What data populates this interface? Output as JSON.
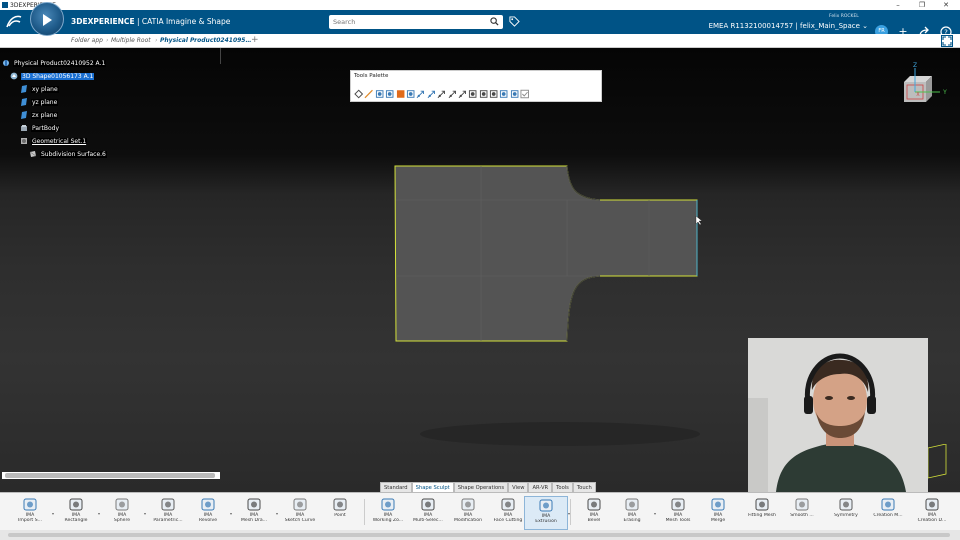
{
  "os": {
    "title": "3DEXPERIENCE"
  },
  "header": {
    "brand_bold": "3DEXPERIENCE",
    "brand_rest": " | CATIA Imagine & Shape",
    "search_placeholder": "Search",
    "user_name": "Felix ROCKEL",
    "avatar_initials": "FR",
    "tenant": "EMEA R1132100014757 | felix_Main_Space ⌄"
  },
  "tabs": {
    "crumb1": "Folder app",
    "crumb2": "Multiple Root",
    "active": "Physical Product0241095…"
  },
  "tree": {
    "root": "Physical Product02410952 A.1",
    "shape": "3D Shape01056173 A.1",
    "xy": "xy plane",
    "yz": "yz plane",
    "zx": "zx plane",
    "partbody": "PartBody",
    "geoset": "Geometrical Set.1",
    "subdiv": "Subdivision Surface.6"
  },
  "palette": {
    "title": "Tools Palette",
    "icons": [
      "point-icon",
      "curve-icon",
      "hide-icon",
      "mesh-icon",
      "color-icon",
      "group-icon",
      "move-icon",
      "move-plane-icon",
      "move-x-icon",
      "move-y-icon",
      "move-z-icon",
      "attract-icon",
      "weight-icon",
      "crease-icon",
      "link-icon",
      "select-icon",
      "validate-icon"
    ]
  },
  "viewcube": {
    "x": "X",
    "y": "Y",
    "z": "Z"
  },
  "section_tabs": [
    "Standard",
    "Shape Sculpt",
    "Shape Operations",
    "View",
    "AR-VR",
    "Tools",
    "Touch"
  ],
  "section_tabs_active": 1,
  "tools": [
    {
      "l1": "IMA",
      "l2": "Import S...",
      "icon": "import-sketch-icon"
    },
    {
      "l1": "IMA",
      "l2": "Rectangle",
      "icon": "rectangle-icon"
    },
    {
      "l1": "IMA",
      "l2": "Sphere",
      "icon": "sphere-icon"
    },
    {
      "l1": "IMA",
      "l2": "Parametric...",
      "icon": "parametric-icon"
    },
    {
      "l1": "IMA",
      "l2": "Revolve",
      "icon": "revolve-icon"
    },
    {
      "l1": "IMA",
      "l2": "Mesh Dra...",
      "icon": "mesh-draw-icon"
    },
    {
      "l1": "IMA",
      "l2": "Sketch Curve",
      "icon": "sketch-curve-icon"
    },
    {
      "l1": "",
      "l2": "Point",
      "icon": "point-icon"
    },
    {
      "l1": "IMA",
      "l2": "Working Zo...",
      "icon": "working-zone-icon"
    },
    {
      "l1": "IMA",
      "l2": "Multi-Selec...",
      "icon": "multi-select-icon"
    },
    {
      "l1": "IMA",
      "l2": "Modification",
      "icon": "modification-icon"
    },
    {
      "l1": "IMA",
      "l2": "Face Cutting",
      "icon": "face-cutting-icon"
    },
    {
      "l1": "IMA",
      "l2": "Extrusion",
      "icon": "extrusion-icon"
    },
    {
      "l1": "IMA",
      "l2": "Bevel",
      "icon": "bevel-icon"
    },
    {
      "l1": "IMA",
      "l2": "Erasing",
      "icon": "erasing-icon"
    },
    {
      "l1": "IMA",
      "l2": "Mesh Tools",
      "icon": "mesh-tools-icon"
    },
    {
      "l1": "IMA",
      "l2": "Merge",
      "icon": "merge-icon"
    },
    {
      "l1": "",
      "l2": "Fitting Mesh",
      "icon": "fitting-mesh-icon"
    },
    {
      "l1": "",
      "l2": "Smooth ...",
      "icon": "smooth-icon"
    },
    {
      "l1": "",
      "l2": "Symmetry",
      "icon": "symmetry-icon"
    },
    {
      "l1": "",
      "l2": "Creation M...",
      "icon": "creation-m-icon"
    },
    {
      "l1": "IMA",
      "l2": "Creation D...",
      "icon": "creation-d-icon"
    }
  ],
  "tools_active": 12,
  "colors": {
    "brand_blue": "#005386",
    "selection_blue": "#1a6fd1",
    "model_edge": "#d4e23a"
  }
}
